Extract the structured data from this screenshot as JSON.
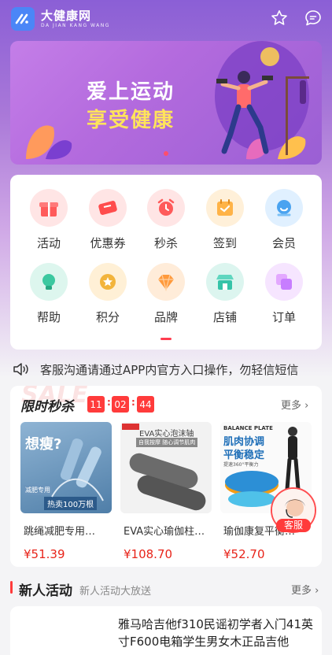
{
  "header": {
    "app_name": "大健康网",
    "app_name_pinyin": "DA JIAN KANG WANG",
    "icons": [
      "star-icon",
      "message-icon"
    ]
  },
  "banner": {
    "line1": "爱上运动",
    "line2": "享受健康"
  },
  "grid": {
    "items": [
      {
        "label": "活动",
        "icon": "gift-icon",
        "color": "#ff6b6b"
      },
      {
        "label": "优惠券",
        "icon": "coupon-icon",
        "color": "#ff5a5a"
      },
      {
        "label": "秒杀",
        "icon": "alarm-icon",
        "color": "#ff6464"
      },
      {
        "label": "签到",
        "icon": "calendar-check-icon",
        "color": "#ffb347"
      },
      {
        "label": "会员",
        "icon": "member-icon",
        "color": "#4aa3f0"
      },
      {
        "label": "帮助",
        "icon": "bulb-icon",
        "color": "#3cc8a0"
      },
      {
        "label": "积分",
        "icon": "points-icon",
        "color": "#f2b43c"
      },
      {
        "label": "品牌",
        "icon": "diamond-icon",
        "color": "#ff9a3c"
      },
      {
        "label": "店铺",
        "icon": "store-icon",
        "color": "#35c3a8"
      },
      {
        "label": "订单",
        "icon": "order-icon",
        "color": "#c77dff"
      }
    ]
  },
  "notice": {
    "text": "客服沟通请通过APP内官方入口操作，勿轻信短信"
  },
  "flash_sale": {
    "bg_word": "SALE",
    "title": "限时秒杀",
    "hours": "11",
    "minutes": "02",
    "seconds": "44",
    "more_label": "更多",
    "products": [
      {
        "name": "跳绳减肥专用…",
        "price": "¥51.39",
        "img_big": "想瘦?",
        "img_sub": "减肥专用",
        "img_tag": "热卖100万根"
      },
      {
        "name": "EVA实心瑜伽柱…",
        "price": "¥108.70",
        "img_tag": "EVA实心泡沫轴",
        "img_sub": "自我按摩 随心调节肌肉"
      },
      {
        "name": "瑜伽康复平衡…",
        "price": "¥52.70",
        "img_tag": "BALANCE PLATE",
        "img_big": "肌肉协调",
        "img_big2": "平衡稳定",
        "img_sub": "提速360°平衡力"
      }
    ]
  },
  "customer_service": {
    "label": "客服"
  },
  "new_activity": {
    "title": "新人活动",
    "subtitle": "新人活动大放送",
    "more_label": "更多",
    "item_text": "雅马哈吉他f310民谣初学者入门41英寸F600电箱学生男女木正品吉他"
  }
}
